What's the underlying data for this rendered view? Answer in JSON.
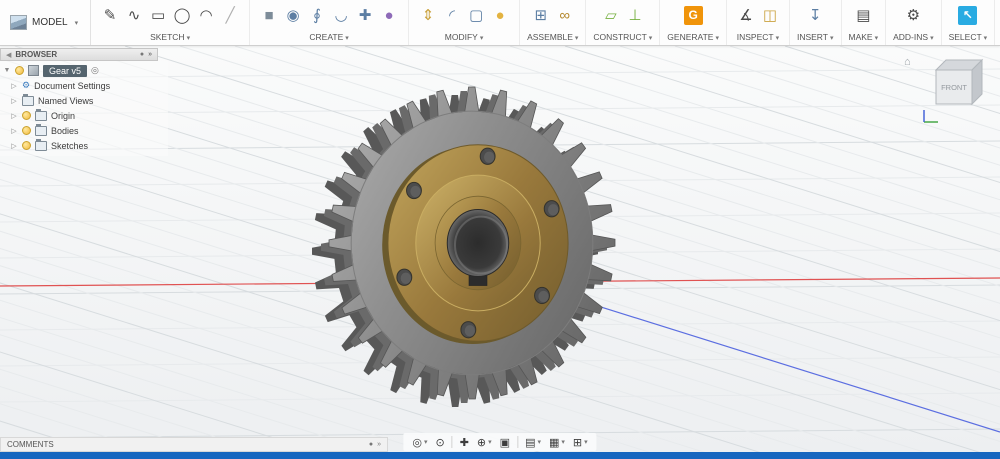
{
  "glyphs": {
    "caret": "▾",
    "collapse_left": "◀",
    "chevrons_right": "»",
    "dot": "●",
    "tree_expanded": "▼",
    "tree_collapsed": "▷",
    "target": "◎",
    "home": "⌂"
  },
  "colors": {
    "accent_blue": "#29abe2",
    "taskbar_blue": "#1666bf",
    "generate_orange": "#f0940a",
    "construct_green": "#76b041",
    "grid_minor": "#e7eaec",
    "grid_major": "#d7dcdf",
    "axis_red": "#e05252",
    "axis_blue": "#5b6ee1",
    "steel_light": "#b2b2b2",
    "steel_mid": "#8f8f8f",
    "steel_dark": "#6b6b6b",
    "steel_side": "#585858",
    "brass_light": "#c2a55c",
    "brass_mid": "#99793c",
    "brass_dark": "#7a6230",
    "bore_dark": "#2c2c2c"
  },
  "toolbar": {
    "model": {
      "label": "MODEL"
    },
    "groups": [
      {
        "label": "SKETCH",
        "icons": [
          {
            "name": "create-sketch",
            "glyph": "✎",
            "color": "#4a4a4a"
          },
          {
            "name": "spline",
            "glyph": "∿",
            "color": "#4a4a4a"
          },
          {
            "name": "rectangle",
            "glyph": "▭",
            "color": "#4a4a4a"
          },
          {
            "name": "circle",
            "glyph": "◯",
            "color": "#4a4a4a"
          },
          {
            "name": "arc",
            "glyph": "◠",
            "color": "#4a4a4a"
          },
          {
            "name": "line",
            "glyph": "╱",
            "color": "#b0b0b0"
          }
        ]
      },
      {
        "label": "CREATE",
        "icons": [
          {
            "name": "box",
            "glyph": "■",
            "color": "#7d8c99"
          },
          {
            "name": "revolve",
            "glyph": "◉",
            "color": "#5c7ea3"
          },
          {
            "name": "sweep",
            "glyph": "∮",
            "color": "#5c7ea3"
          },
          {
            "name": "loft",
            "glyph": "◡",
            "color": "#5c7ea3"
          },
          {
            "name": "coil",
            "glyph": "✚",
            "color": "#5c7ea3"
          },
          {
            "name": "create-form",
            "glyph": "●",
            "color": "#8e6bb8"
          }
        ]
      },
      {
        "label": "MODIFY",
        "icons": [
          {
            "name": "press-pull",
            "glyph": "⇕",
            "color": "#caa23e"
          },
          {
            "name": "fillet",
            "glyph": "◜",
            "color": "#5c7ea3"
          },
          {
            "name": "shell",
            "glyph": "▢",
            "color": "#5c7ea3"
          },
          {
            "name": "combine",
            "glyph": "●",
            "color": "#e3b341"
          }
        ]
      },
      {
        "label": "ASSEMBLE",
        "icons": [
          {
            "name": "new-component",
            "glyph": "⊞",
            "color": "#5c7ea3"
          },
          {
            "name": "joint",
            "glyph": "∞",
            "color": "#b5892f"
          }
        ]
      },
      {
        "label": "CONSTRUCT",
        "icons": [
          {
            "name": "offset-plane",
            "glyph": "▱",
            "color": "#76b041"
          },
          {
            "name": "axis",
            "glyph": "⊥",
            "color": "#76b041"
          }
        ]
      },
      {
        "label": "GENERATE",
        "icons": [
          {
            "name": "generate",
            "glyph": "G",
            "bg": "#f0940a"
          }
        ]
      },
      {
        "label": "INSPECT",
        "icons": [
          {
            "name": "measure",
            "glyph": "∡",
            "color": "#4a4a4a"
          },
          {
            "name": "section-analysis",
            "glyph": "◫",
            "color": "#caa23e"
          }
        ]
      },
      {
        "label": "INSERT",
        "icons": [
          {
            "name": "insert",
            "glyph": "↧",
            "color": "#5c7ea3"
          }
        ]
      },
      {
        "label": "MAKE",
        "icons": [
          {
            "name": "3d-print",
            "glyph": "▤",
            "color": "#4a4a4a"
          }
        ]
      },
      {
        "label": "ADD-INS",
        "icons": [
          {
            "name": "scripts-and-addins",
            "glyph": "⚙",
            "color": "#4a4a4a"
          }
        ]
      },
      {
        "label": "SELECT",
        "icons": [
          {
            "name": "select",
            "glyph": "↖",
            "bg": "#29abe2"
          }
        ]
      }
    ]
  },
  "browser": {
    "header": "BROWSER",
    "root_label": "Gear v5",
    "items": [
      {
        "name": "document-settings",
        "label": "Document Settings",
        "bulb": false,
        "icon": "gear"
      },
      {
        "name": "named-views",
        "label": "Named Views",
        "bulb": false,
        "icon": "folder"
      },
      {
        "name": "origin",
        "label": "Origin",
        "bulb": true,
        "icon": "folder"
      },
      {
        "name": "bodies",
        "label": "Bodies",
        "bulb": true,
        "icon": "folder"
      },
      {
        "name": "sketches",
        "label": "Sketches",
        "bulb": true,
        "icon": "folder"
      }
    ]
  },
  "viewcube": {
    "face": "FRONT"
  },
  "comments": {
    "label": "COMMENTS"
  },
  "nav": {
    "items": [
      {
        "name": "orbit",
        "glyph": "◎",
        "caret": true
      },
      {
        "name": "look-at",
        "glyph": "⊙",
        "caret": false
      },
      {
        "sep": true
      },
      {
        "name": "pan",
        "glyph": "✚",
        "caret": false
      },
      {
        "name": "zoom",
        "glyph": "⊕",
        "caret": true
      },
      {
        "name": "fit",
        "glyph": "▣",
        "caret": false
      },
      {
        "sep": true
      },
      {
        "name": "display-settings",
        "glyph": "▤",
        "caret": true
      },
      {
        "name": "grid-and-snaps",
        "glyph": "▦",
        "caret": true
      },
      {
        "name": "viewports",
        "glyph": "⊞",
        "caret": true
      }
    ]
  },
  "model3d": {
    "name": "gear",
    "teeth": 28
  }
}
